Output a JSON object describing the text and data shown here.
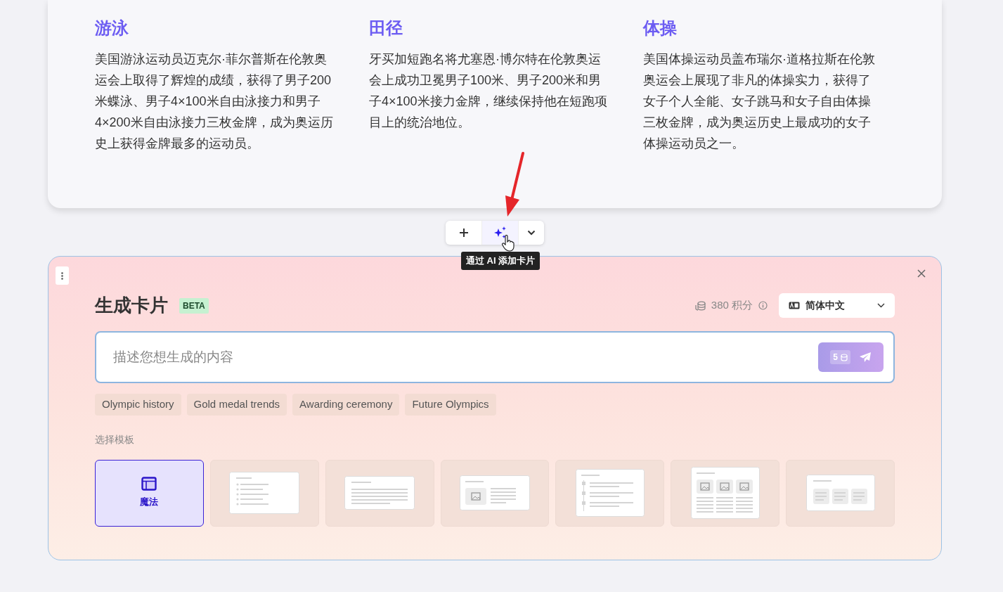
{
  "sports": [
    {
      "title": "游泳",
      "text": "美国游泳运动员迈克尔·菲尔普斯在伦敦奥运会上取得了辉煌的成绩，获得了男子200米蝶泳、男子4×100米自由泳接力和男子4×200米自由泳接力三枚金牌，成为奥运历史上获得金牌最多的运动员。"
    },
    {
      "title": "田径",
      "text": "牙买加短跑名将尤塞恩·博尔特在伦敦奥运会上成功卫冕男子100米、男子200米和男子4×100米接力金牌，继续保持他在短跑项目上的统治地位。"
    },
    {
      "title": "体操",
      "text": "美国体操运动员盖布瑞尔·道格拉斯在伦敦奥运会上展现了非凡的体操实力，获得了女子个人全能、女子跳马和女子自由体操三枚金牌，成为奥运历史上最成功的女子体操运动员之一。"
    }
  ],
  "toolbar": {
    "buttons": [
      {
        "kind": "add",
        "selected": false
      },
      {
        "kind": "ai",
        "selected": true
      },
      {
        "kind": "more",
        "selected": false
      }
    ],
    "tooltip": "通过 AI 添加卡片"
  },
  "generator": {
    "title": "生成卡片",
    "badge": "BETA",
    "credits": "380 积分",
    "language": "简体中文",
    "prompt": {
      "placeholder": "描述您想生成的内容"
    },
    "send_cost": "5",
    "suggestions": [
      "Olympic history",
      "Gold medal trends",
      "Awarding ceremony",
      "Future Olympics"
    ],
    "template_label": "选择模板",
    "templates": [
      {
        "kind": "magic",
        "label": "魔法",
        "selected": true
      },
      {
        "kind": "list",
        "selected": false
      },
      {
        "kind": "text",
        "selected": false
      },
      {
        "kind": "image-text",
        "selected": false
      },
      {
        "kind": "timeline",
        "selected": false
      },
      {
        "kind": "image-grid",
        "selected": false
      },
      {
        "kind": "columns",
        "selected": false
      }
    ]
  }
}
